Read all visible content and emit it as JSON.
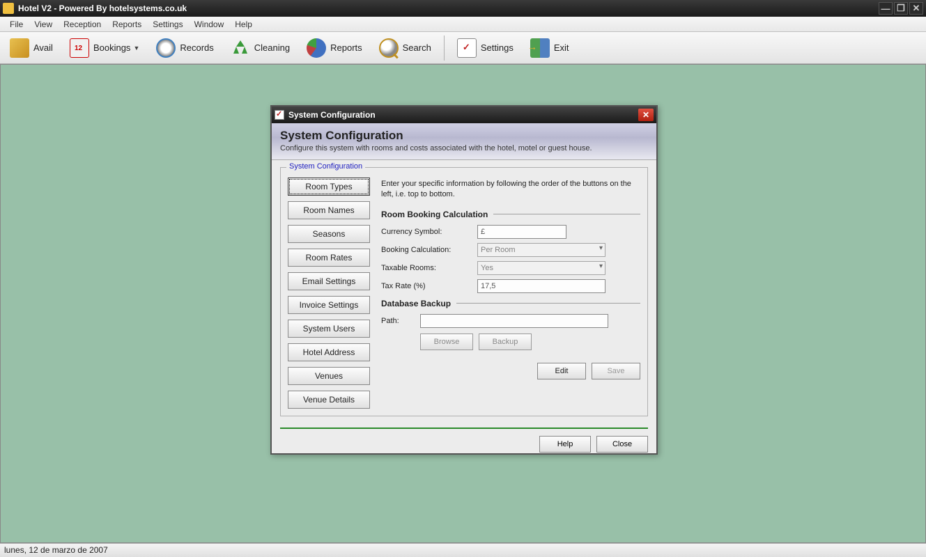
{
  "window": {
    "title": "Hotel V2 - Powered By hotelsystems.co.uk"
  },
  "menubar": {
    "items": [
      "File",
      "View",
      "Reception",
      "Reports",
      "Settings",
      "Window",
      "Help"
    ]
  },
  "toolbar": {
    "avail": "Avail",
    "bookings": "Bookings",
    "records": "Records",
    "cleaning": "Cleaning",
    "reports": "Reports",
    "search": "Search",
    "settings": "Settings",
    "exit": "Exit"
  },
  "dialog": {
    "title": "System Configuration",
    "header_title": "System Configuration",
    "header_subtitle": "Configure this system with rooms and costs associated with the hotel, motel or guest house.",
    "fieldset_legend": "System Configuration",
    "nav": [
      "Room Types",
      "Room Names",
      "Seasons",
      "Room Rates",
      "Email Settings",
      "Invoice Settings",
      "System Users",
      "Hotel Address",
      "Venues",
      "Venue Details"
    ],
    "intro": "Enter your specific information by following the order of the buttons on the left, i.e. top to bottom.",
    "section_booking": "Room Booking Calculation",
    "labels": {
      "currency": "Currency Symbol:",
      "calc": "Booking Calculation:",
      "taxable": "Taxable Rooms:",
      "taxrate": "Tax Rate (%)"
    },
    "values": {
      "currency": "£",
      "calc": "Per Room",
      "taxable": "Yes",
      "taxrate": "17,5",
      "path": ""
    },
    "section_backup": "Database Backup",
    "path_label": "Path:",
    "buttons": {
      "browse": "Browse",
      "backup": "Backup",
      "edit": "Edit",
      "save": "Save",
      "help": "Help",
      "close": "Close"
    }
  },
  "statusbar": {
    "text": "lunes, 12 de marzo de 2007"
  }
}
